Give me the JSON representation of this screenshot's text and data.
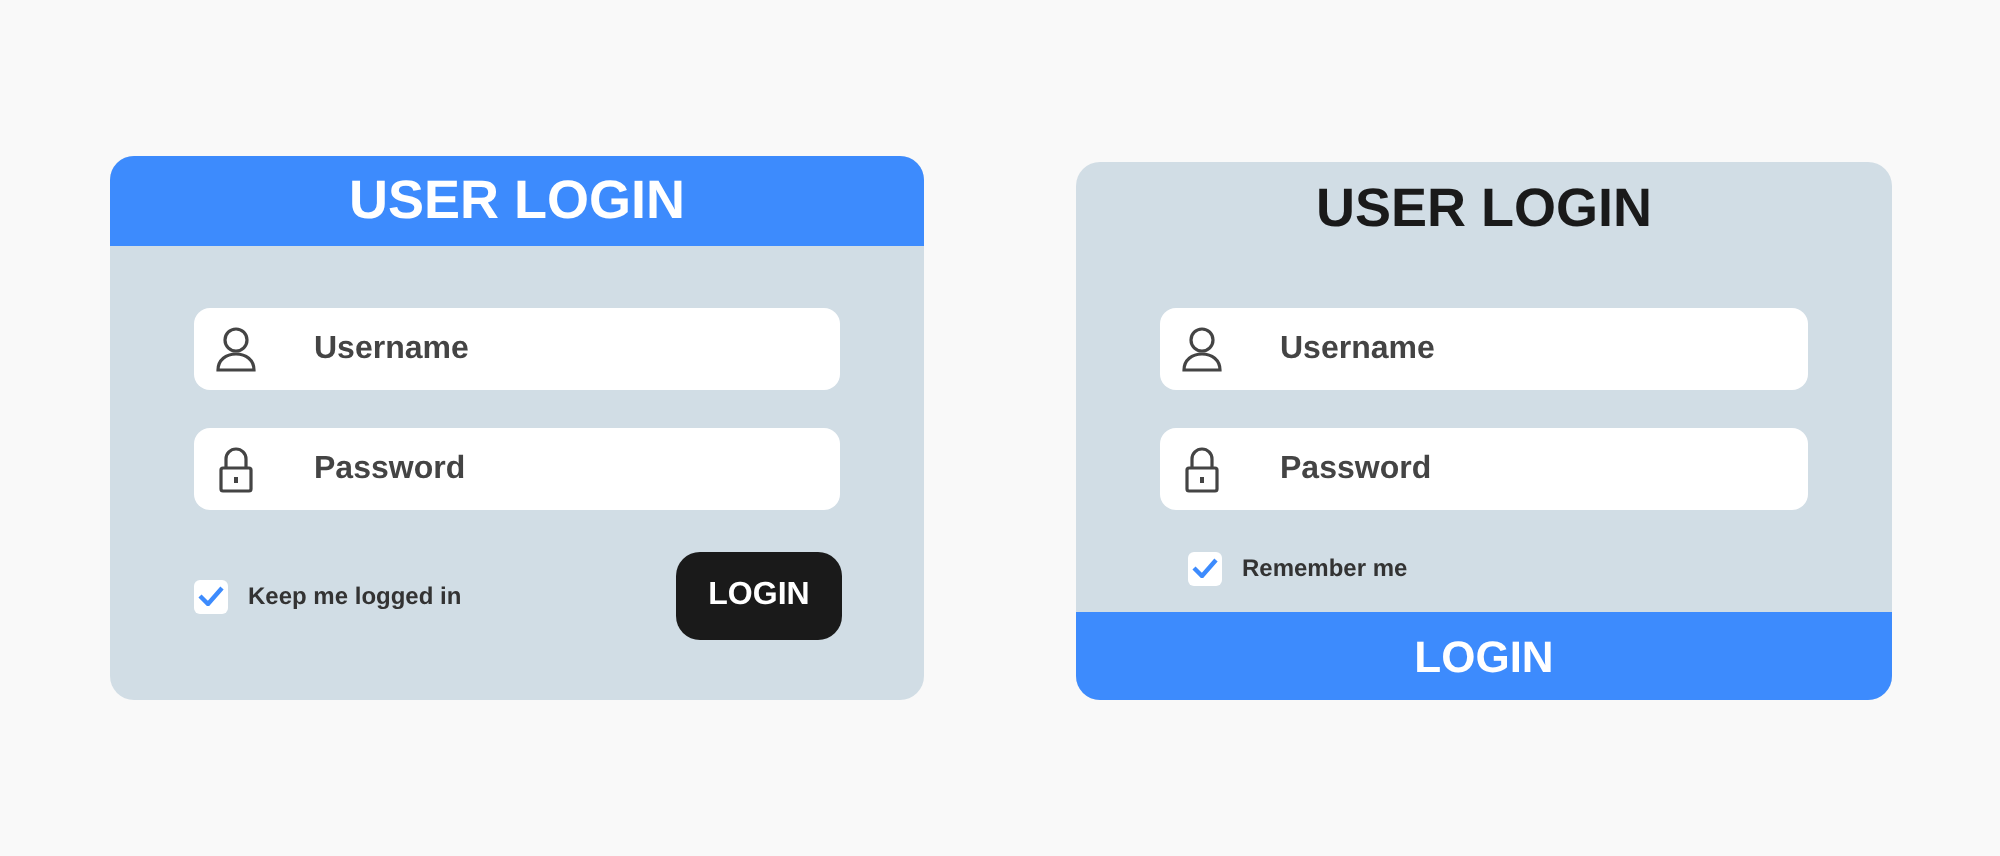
{
  "forms": [
    {
      "title": {
        "text": "USER LOGIN",
        "kind": "banner"
      },
      "fields": [
        {
          "kind": "user",
          "placeholder": "Username"
        },
        {
          "kind": "lock",
          "placeholder": "Password"
        }
      ],
      "checkbox": {
        "label": "Keep me logged in",
        "checked": true
      },
      "button": {
        "label": "LOGIN",
        "kind": "pill"
      }
    },
    {
      "title": {
        "text": "USER LOGIN",
        "kind": "plain"
      },
      "fields": [
        {
          "kind": "user",
          "placeholder": "Username"
        },
        {
          "kind": "lock",
          "placeholder": "Password"
        }
      ],
      "checkbox": {
        "label": "Remember me",
        "checked": true
      },
      "button": {
        "label": "LOGIN",
        "kind": "bar"
      }
    }
  ]
}
